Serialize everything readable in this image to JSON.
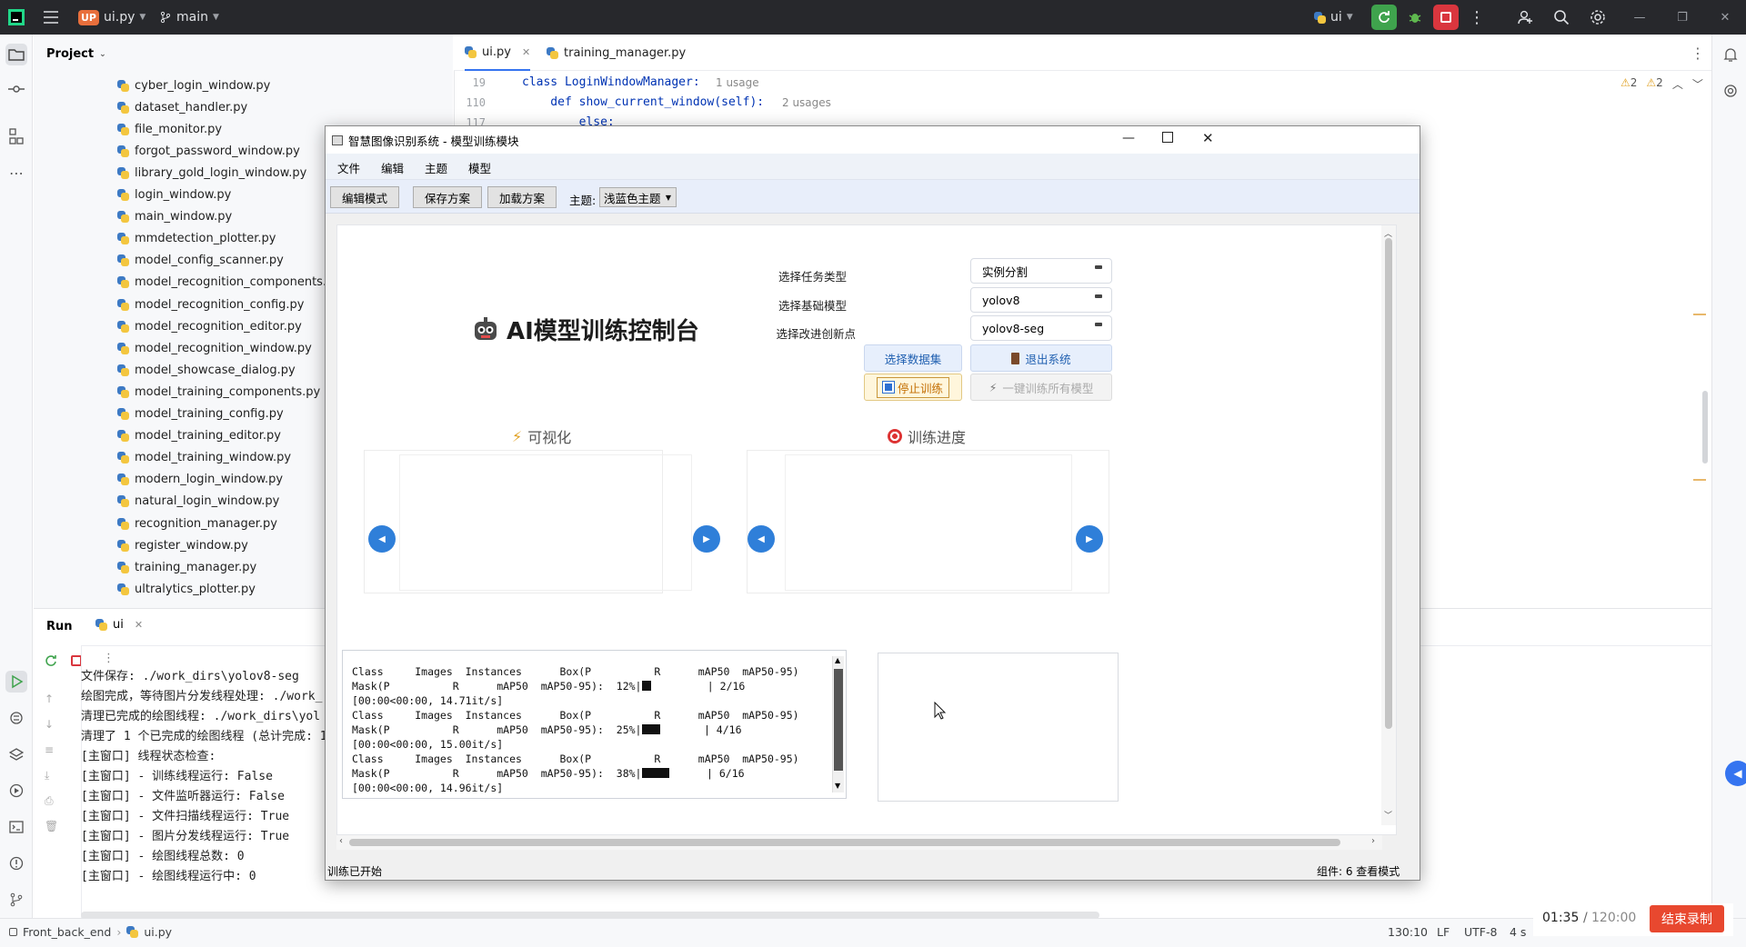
{
  "ide": {
    "project_badge": "UP",
    "project_file": "ui.py",
    "branch": "main",
    "run_config": "ui",
    "project_label": "Project",
    "tabs": [
      {
        "label": "ui.py",
        "active": true
      },
      {
        "label": "training_manager.py",
        "active": false
      }
    ],
    "code_lines": [
      {
        "num": "19",
        "code": "class LoginWindowManager:",
        "hint": "1 usage"
      },
      {
        "num": "110",
        "code": "    def show_current_window(self):",
        "hint": "2 usages"
      },
      {
        "num": "117",
        "code": "        else:",
        "hint": ""
      }
    ],
    "inspections": {
      "warn_a": "2",
      "warn_b": "2"
    },
    "files": [
      "cyber_login_window.py",
      "dataset_handler.py",
      "file_monitor.py",
      "forgot_password_window.py",
      "library_gold_login_window.py",
      "login_window.py",
      "main_window.py",
      "mmdetection_plotter.py",
      "model_config_scanner.py",
      "model_recognition_components.py",
      "model_recognition_config.py",
      "model_recognition_editor.py",
      "model_recognition_window.py",
      "model_showcase_dialog.py",
      "model_training_components.py",
      "model_training_config.py",
      "model_training_editor.py",
      "model_training_window.py",
      "modern_login_window.py",
      "natural_login_window.py",
      "recognition_manager.py",
      "register_window.py",
      "training_manager.py",
      "ultralytics_plotter.py"
    ],
    "run": {
      "title": "Run",
      "tab": "ui",
      "lines": [
        "文件保存: ./work_dirs\\yolov8-seg",
        "绘图完成，等待图片分发线程处理: ./work_",
        "清理已完成的绘图线程: ./work_dirs\\yol",
        "清理了 1 个已完成的绘图线程 (总计完成: 1",
        "[主窗口] 线程状态检查:",
        "[主窗口] - 训练线程运行: False",
        "[主窗口] - 文件监听器运行: False",
        "[主窗口] - 文件扫描线程运行: True",
        "[主窗口] - 图片分发线程运行: True",
        "[主窗口] - 绘图线程总数: 0",
        "[主窗口] - 绘图线程运行中: 0"
      ]
    },
    "status": {
      "breadcrumb_root": "Front_back_end",
      "breadcrumb_file": "ui.py",
      "position": "130:10",
      "line_sep": "LF",
      "encoding": "UTF-8",
      "indent": "4 s"
    },
    "recording": {
      "elapsed": "01:35",
      "total": "120:00",
      "stop_label": "结束录制"
    }
  },
  "app": {
    "title": "智慧图像识别系统 - 模型训练模块",
    "menu": [
      "文件",
      "编辑",
      "主题",
      "模型"
    ],
    "toolbar": {
      "edit_mode": "编辑模式",
      "save_plan": "保存方案",
      "load_plan": "加载方案",
      "theme_label": "主题:",
      "theme_value": "浅蓝色主题"
    },
    "heading": "AI模型训练控制台",
    "task_type": {
      "label": "选择任务类型",
      "value": "实例分割"
    },
    "base_model": {
      "label": "选择基础模型",
      "value": "yolov8"
    },
    "innovation": {
      "label": "选择改进创新点",
      "value": "yolov8-seg"
    },
    "buttons": {
      "select_dataset": "选择数据集",
      "exit_system": "退出系统",
      "stop_training": "停止训练",
      "train_all": "一键训练所有模型"
    },
    "sections": {
      "visual": "可视化",
      "progress": "训练进度"
    },
    "log_lines": [
      {
        "text": "Class     Images  Instances      Box(P          R      mAP50  mAP50-95)",
        "bar": null
      },
      {
        "text": "Mask(P          R      mAP50  mAP50-95):  12%|",
        "bar": 0.12,
        "suffix": "         | 2/16"
      },
      {
        "text": "[00:00<00:00, 14.71it/s]",
        "bar": null
      },
      {
        "text": "Class     Images  Instances      Box(P          R      mAP50  mAP50-95)",
        "bar": null
      },
      {
        "text": "Mask(P          R      mAP50  mAP50-95):  25%|",
        "bar": 0.25,
        "suffix": "       | 4/16"
      },
      {
        "text": "[00:00<00:00, 15.00it/s]",
        "bar": null
      },
      {
        "text": "Class     Images  Instances      Box(P          R      mAP50  mAP50-95)",
        "bar": null
      },
      {
        "text": "Mask(P          R      mAP50  mAP50-95):  38%|",
        "bar": 0.38,
        "suffix": "      | 6/16"
      },
      {
        "text": "[00:00<00:00, 14.96it/s]",
        "bar": null
      }
    ],
    "status_left": "训练已开始",
    "status_right": "组件: 6  查看模式"
  },
  "colors": {
    "ide_titlebar": "#27282c",
    "run_green": "#3fa34d",
    "stop_red": "#d9363e",
    "app_accent": "#2f7fd9",
    "record_button": "#e8482f"
  }
}
